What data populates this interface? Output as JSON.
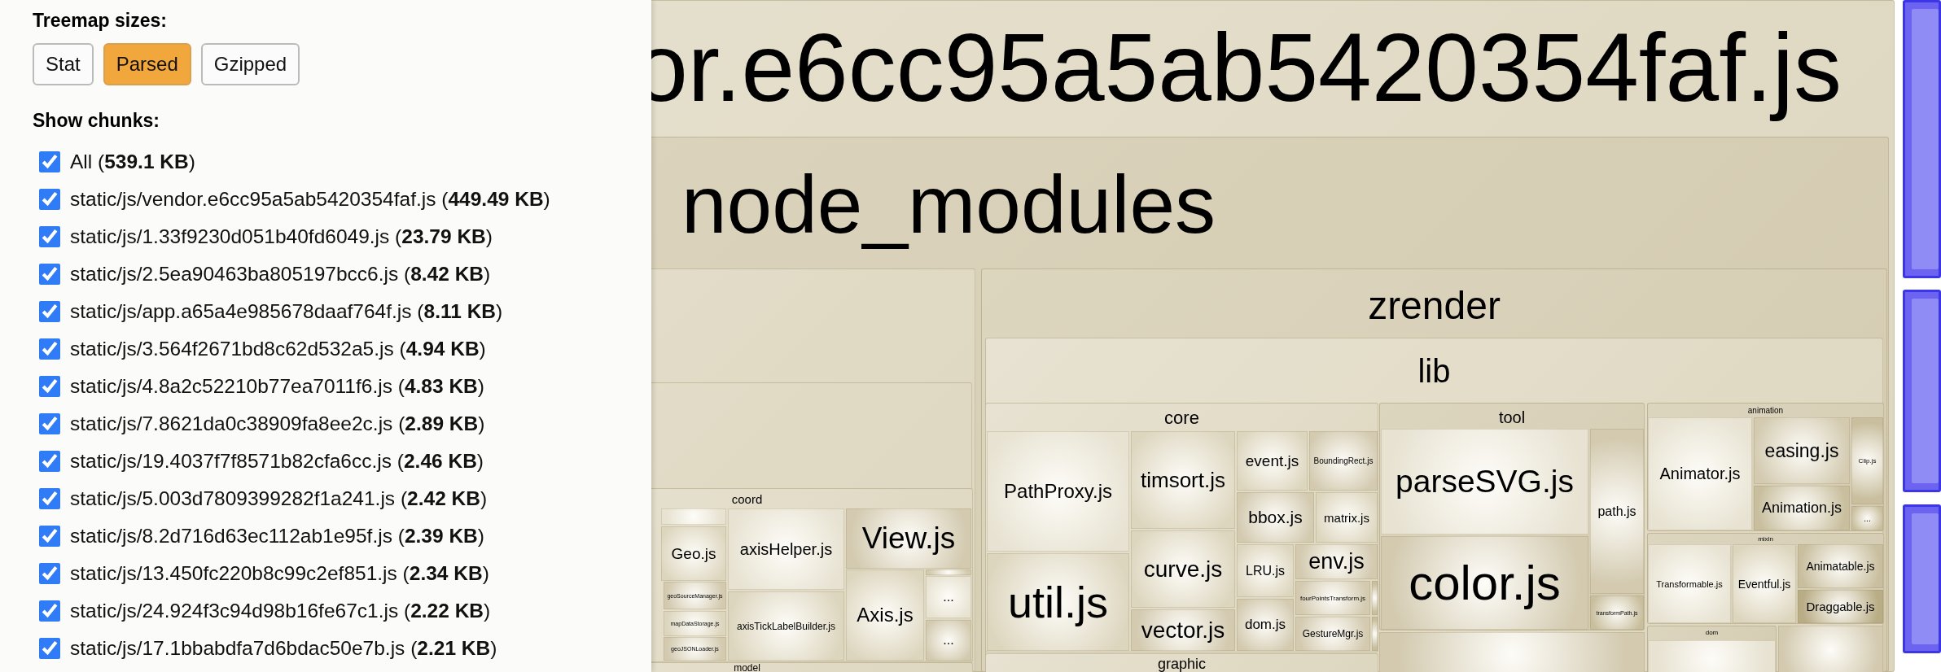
{
  "sidebar": {
    "sizes_label": "Treemap sizes:",
    "size_buttons": [
      {
        "label": "Stat",
        "selected": false
      },
      {
        "label": "Parsed",
        "selected": true
      },
      {
        "label": "Gzipped",
        "selected": false
      }
    ],
    "chunks_label": "Show chunks:",
    "chunks": [
      {
        "label": "All (**539.1 KB**)",
        "checked": true
      },
      {
        "label": "static/js/vendor.e6cc95a5ab5420354faf.js (**449.49 KB**)",
        "checked": true
      },
      {
        "label": "static/js/1.33f9230d051b40fd6049.js (**23.79 KB**)",
        "checked": true
      },
      {
        "label": "static/js/2.5ea90463ba805197bcc6.js (**8.42 KB**)",
        "checked": true
      },
      {
        "label": "static/js/app.a65a4e985678daaf764f.js (**8.11 KB**)",
        "checked": true
      },
      {
        "label": "static/js/3.564f2671bd8c62d532a5.js (**4.94 KB**)",
        "checked": true
      },
      {
        "label": "static/js/4.8a2c52210b77ea7011f6.js (**4.83 KB**)",
        "checked": true
      },
      {
        "label": "static/js/7.8621da0c38909fa8ee2c.js (**2.89 KB**)",
        "checked": true
      },
      {
        "label": "static/js/19.4037f7f8571b82cfa6cc.js (**2.46 KB**)",
        "checked": true
      },
      {
        "label": "static/js/5.003d7809399282f1a241.js (**2.42 KB**)",
        "checked": true
      },
      {
        "label": "static/js/8.2d716d63ec112ab1e95f.js (**2.39 KB**)",
        "checked": true
      },
      {
        "label": "static/js/13.450fc220b8c99c2ef851.js (**2.34 KB**)",
        "checked": true
      },
      {
        "label": "static/js/24.924f3c94d98b16fe67c1.js (**2.22 KB**)",
        "checked": true
      },
      {
        "label": "static/js/17.1bbabdfa7d6bdac50e7b.js (**2.21 KB**)",
        "checked": true
      }
    ]
  },
  "treemap": {
    "kind": "folder",
    "label": "or.e6cc95a5ab5420354faf.js",
    "children": [
      {
        "kind": "folder",
        "label": "node_modules",
        "children": [
          {
            "kind": "folder",
            "children": [
              {
                "kind": "folder",
                "children": [
                  {
                    "kind": "folder",
                    "label": "coord",
                    "children": [
                      {
                        "kind": "file",
                        "label": "Geo.js"
                      },
                      {
                        "kind": "file",
                        "label": "geoSourceManager.js"
                      },
                      {
                        "kind": "file",
                        "label": "mapDataStorage.js"
                      },
                      {
                        "kind": "file",
                        "label": "geoJSONLoader.js"
                      },
                      {
                        "kind": "file",
                        "label": "axisHelper.js"
                      },
                      {
                        "kind": "file",
                        "label": "axisTickLabelBuilder.js"
                      },
                      {
                        "kind": "file",
                        "label": "View.js"
                      },
                      {
                        "kind": "file",
                        "label": "Axis.js"
                      },
                      {
                        "kind": "file",
                        "label": "..."
                      },
                      {
                        "kind": "file",
                        "label": "..."
                      }
                    ]
                  },
                  {
                    "kind": "folder",
                    "label": "model"
                  }
                ]
              }
            ]
          },
          {
            "kind": "folder",
            "label": "zrender",
            "children": [
              {
                "kind": "folder",
                "label": "lib",
                "children": [
                  {
                    "kind": "folder",
                    "label": "core",
                    "children": [
                      {
                        "kind": "file",
                        "label": "PathProxy.js"
                      },
                      {
                        "kind": "file",
                        "label": "util.js"
                      },
                      {
                        "kind": "file",
                        "label": "timsort.js"
                      },
                      {
                        "kind": "file",
                        "label": "curve.js"
                      },
                      {
                        "kind": "file",
                        "label": "vector.js"
                      },
                      {
                        "kind": "file",
                        "label": "event.js"
                      },
                      {
                        "kind": "file",
                        "label": "BoundingRect.js"
                      },
                      {
                        "kind": "file",
                        "label": "bbox.js"
                      },
                      {
                        "kind": "file",
                        "label": "matrix.js"
                      },
                      {
                        "kind": "file",
                        "label": "LRU.js"
                      },
                      {
                        "kind": "file",
                        "label": "dom.js"
                      },
                      {
                        "kind": "file",
                        "label": "env.js"
                      },
                      {
                        "kind": "file",
                        "label": "fourPointsTransform.js"
                      },
                      {
                        "kind": "file",
                        "label": "GestureMgr.js"
                      }
                    ]
                  },
                  {
                    "kind": "folder",
                    "label": "graphic"
                  },
                  {
                    "kind": "folder",
                    "label": "tool",
                    "children": [
                      {
                        "kind": "file",
                        "label": "parseSVG.js"
                      },
                      {
                        "kind": "file",
                        "label": "color.js"
                      },
                      {
                        "kind": "file",
                        "label": "path.js"
                      },
                      {
                        "kind": "file",
                        "label": "transformPath.js"
                      }
                    ]
                  },
                  {
                    "kind": "folder",
                    "label": "animation",
                    "children": [
                      {
                        "kind": "file",
                        "label": "Animator.js"
                      },
                      {
                        "kind": "file",
                        "label": "easing.js"
                      },
                      {
                        "kind": "file",
                        "label": "Animation.js"
                      },
                      {
                        "kind": "file",
                        "label": "Clip.js"
                      },
                      {
                        "kind": "file",
                        "label": "..."
                      }
                    ]
                  },
                  {
                    "kind": "folder",
                    "label": "mixin",
                    "children": [
                      {
                        "kind": "file",
                        "label": "Transformable.js"
                      },
                      {
                        "kind": "file",
                        "label": "Eventful.js"
                      },
                      {
                        "kind": "file",
                        "label": "Animatable.js"
                      },
                      {
                        "kind": "file",
                        "label": "Draggable.js"
                      }
                    ]
                  },
                  {
                    "kind": "folder",
                    "label": "dom"
                  }
                ]
              }
            ]
          }
        ]
      }
    ]
  }
}
